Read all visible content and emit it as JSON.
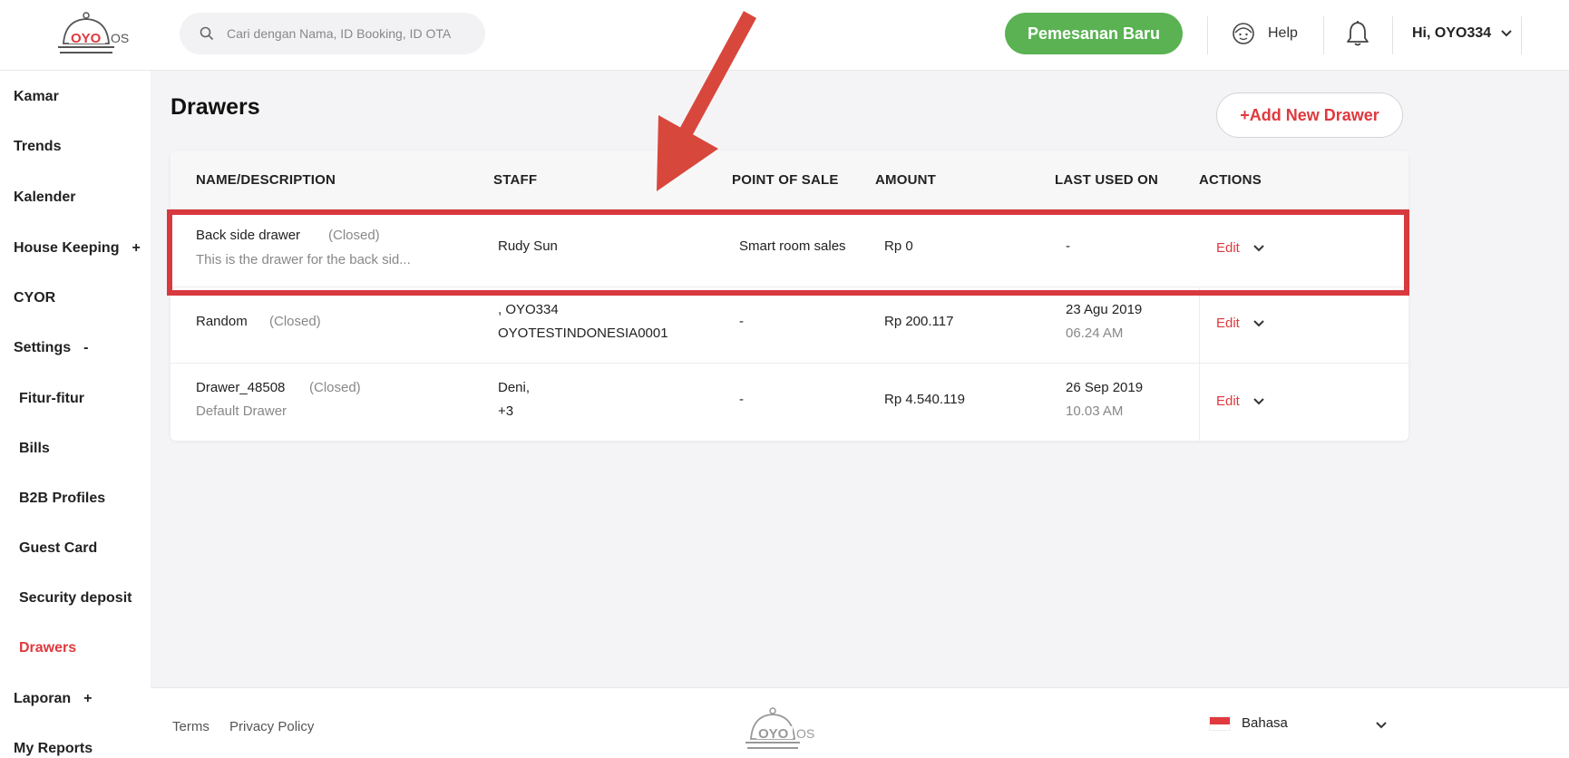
{
  "header": {
    "logo_text": "OYO",
    "logo_suffix": "OS",
    "search_placeholder": "Cari dengan Nama, ID Booking, ID OTA",
    "new_booking_label": "Pemesanan Baru",
    "help_label": "Help",
    "user_greeting": "Hi, OYO334"
  },
  "sidebar": {
    "items": [
      {
        "label": "Kamar"
      },
      {
        "label": "Trends"
      },
      {
        "label": "Kalender"
      },
      {
        "label": "House Keeping",
        "toggle": "+"
      },
      {
        "label": "CYOR"
      },
      {
        "label": "Settings",
        "toggle": "-"
      },
      {
        "label": "Fitur-fitur"
      },
      {
        "label": "Bills"
      },
      {
        "label": "B2B Profiles"
      },
      {
        "label": "Guest Card"
      },
      {
        "label": "Security deposit"
      },
      {
        "label": "Drawers"
      },
      {
        "label": "Laporan",
        "toggle": "+"
      },
      {
        "label": "My Reports"
      }
    ]
  },
  "main": {
    "title": "Drawers",
    "add_button": "+Add New Drawer",
    "columns": [
      "NAME/DESCRIPTION",
      "STAFF",
      "POINT OF SALE",
      "AMOUNT",
      "LAST USED ON",
      "ACTIONS"
    ],
    "rows": [
      {
        "name": "Back side drawer",
        "status": "(Closed)",
        "description": "This is the drawer for the back sid...",
        "staff_line1": "Rudy Sun",
        "staff_line2": "",
        "pos": "Smart room sales",
        "amount": "Rp 0",
        "last_used_date": "-",
        "last_used_time": "",
        "action": "Edit"
      },
      {
        "name": "Random",
        "status": "(Closed)",
        "description": "",
        "staff_line1": ", OYO334",
        "staff_line2": "OYOTESTINDONESIA0001",
        "pos": "-",
        "amount": "Rp 200.117",
        "last_used_date": "23 Agu 2019",
        "last_used_time": "06.24 AM",
        "action": "Edit"
      },
      {
        "name": "Drawer_48508",
        "status": "(Closed)",
        "description": "Default Drawer",
        "staff_line1": "Deni,",
        "staff_line2": "+3",
        "pos": "-",
        "amount": "Rp 4.540.119",
        "last_used_date": "26 Sep 2019",
        "last_used_time": "10.03 AM",
        "action": "Edit"
      }
    ]
  },
  "footer": {
    "terms": "Terms",
    "privacy": "Privacy Policy",
    "language": "Bahasa"
  },
  "colors": {
    "brand_red": "#e0393e",
    "new_booking_green": "#5ab253",
    "annotation_red": "#d8393e"
  },
  "icons": [
    "search-icon",
    "help-face-icon",
    "bell-icon",
    "chevron-down-icon",
    "indonesia-flag-icon",
    "annotation-arrow"
  ]
}
